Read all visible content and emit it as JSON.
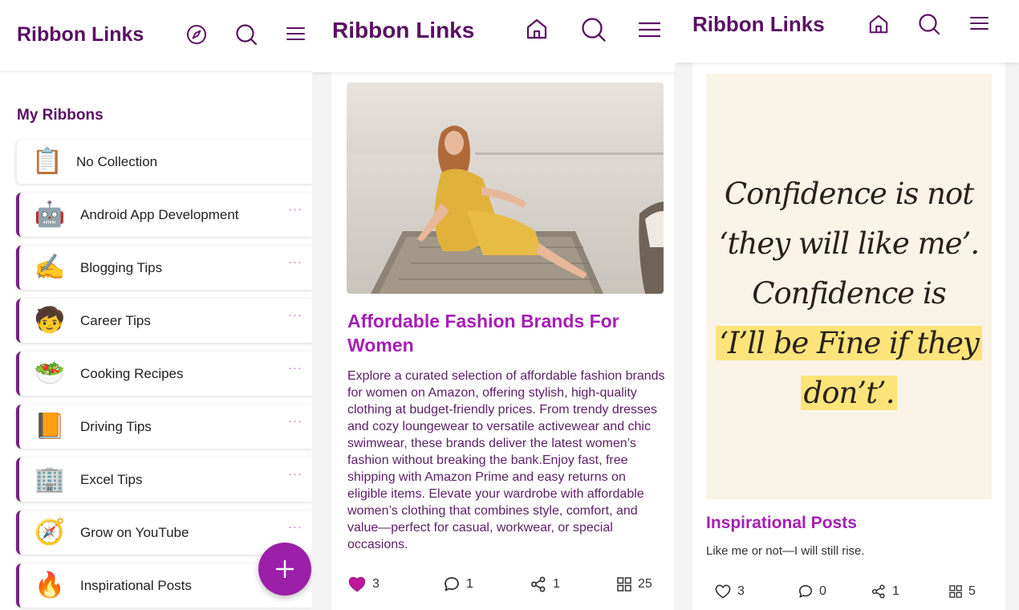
{
  "app_name": "Ribbon Links",
  "colors": {
    "brand": "#5a0f63",
    "accent": "#9b1fa8",
    "post_title": "#a51fb3",
    "heart": "#c2179a"
  },
  "panel1": {
    "header": {
      "title": "Ribbon Links",
      "icons": [
        "compass-icon",
        "search-icon",
        "menu-icon"
      ]
    },
    "section_title": "My Ribbons",
    "ribbons": [
      {
        "label": "No Collection",
        "icon": "clipboard-icon",
        "emoji": "📋"
      },
      {
        "label": "Android App Development",
        "icon": "robot-icon",
        "emoji": "🤖"
      },
      {
        "label": "Blogging Tips",
        "icon": "writing-hand-icon",
        "emoji": "✍️"
      },
      {
        "label": "Career Tips",
        "icon": "boy-icon",
        "emoji": "🧒"
      },
      {
        "label": "Cooking Recipes",
        "icon": "salad-bowl-icon",
        "emoji": "🥗"
      },
      {
        "label": "Driving Tips",
        "icon": "notebook-icon",
        "emoji": "📙"
      },
      {
        "label": "Excel Tips",
        "icon": "office-building-icon",
        "emoji": "🏢"
      },
      {
        "label": "Grow on YouTube",
        "icon": "compass-emoji-icon",
        "emoji": "🧭"
      },
      {
        "label": "Inspirational Posts",
        "icon": "fire-icon",
        "emoji": "🔥"
      }
    ],
    "more_label": "···",
    "fab_label": "+"
  },
  "panel2": {
    "header": {
      "title": "Ribbon Links",
      "icons": [
        "home-icon",
        "search-icon",
        "menu-icon"
      ]
    },
    "post": {
      "image": "woman-in-yellow-dress-on-pier-photo",
      "title": "Affordable Fashion Brands For Women",
      "description": "Explore a curated selection of affordable fashion brands for women on Amazon, offering stylish, high-quality clothing at budget-friendly prices. From trendy dresses and cozy loungewear to versatile activewear and chic swimwear, these brands deliver the latest women’s fashion without breaking the bank.Enjoy fast, free shipping with Amazon Prime and easy returns on eligible items. Elevate your wardrobe with affordable women’s clothing that combines style, comfort, and value—perfect for casual, workwear, or special occasions.",
      "likes": "3",
      "liked": true,
      "comments": "1",
      "shares": "1",
      "collections": "25"
    }
  },
  "panel3": {
    "header": {
      "title": "Ribbon Links",
      "icons": [
        "home-icon",
        "search-icon",
        "menu-icon"
      ]
    },
    "post": {
      "quote_lines": [
        "Confidence is not",
        "‘they will like me’.",
        "Confidence is",
        "‘I’ll be Fine if they",
        "don’t’."
      ],
      "title": "Inspirational Posts",
      "description": "Like me or not—I will still rise.",
      "likes": "3",
      "comments": "0",
      "shares": "1",
      "collections": "5"
    }
  }
}
